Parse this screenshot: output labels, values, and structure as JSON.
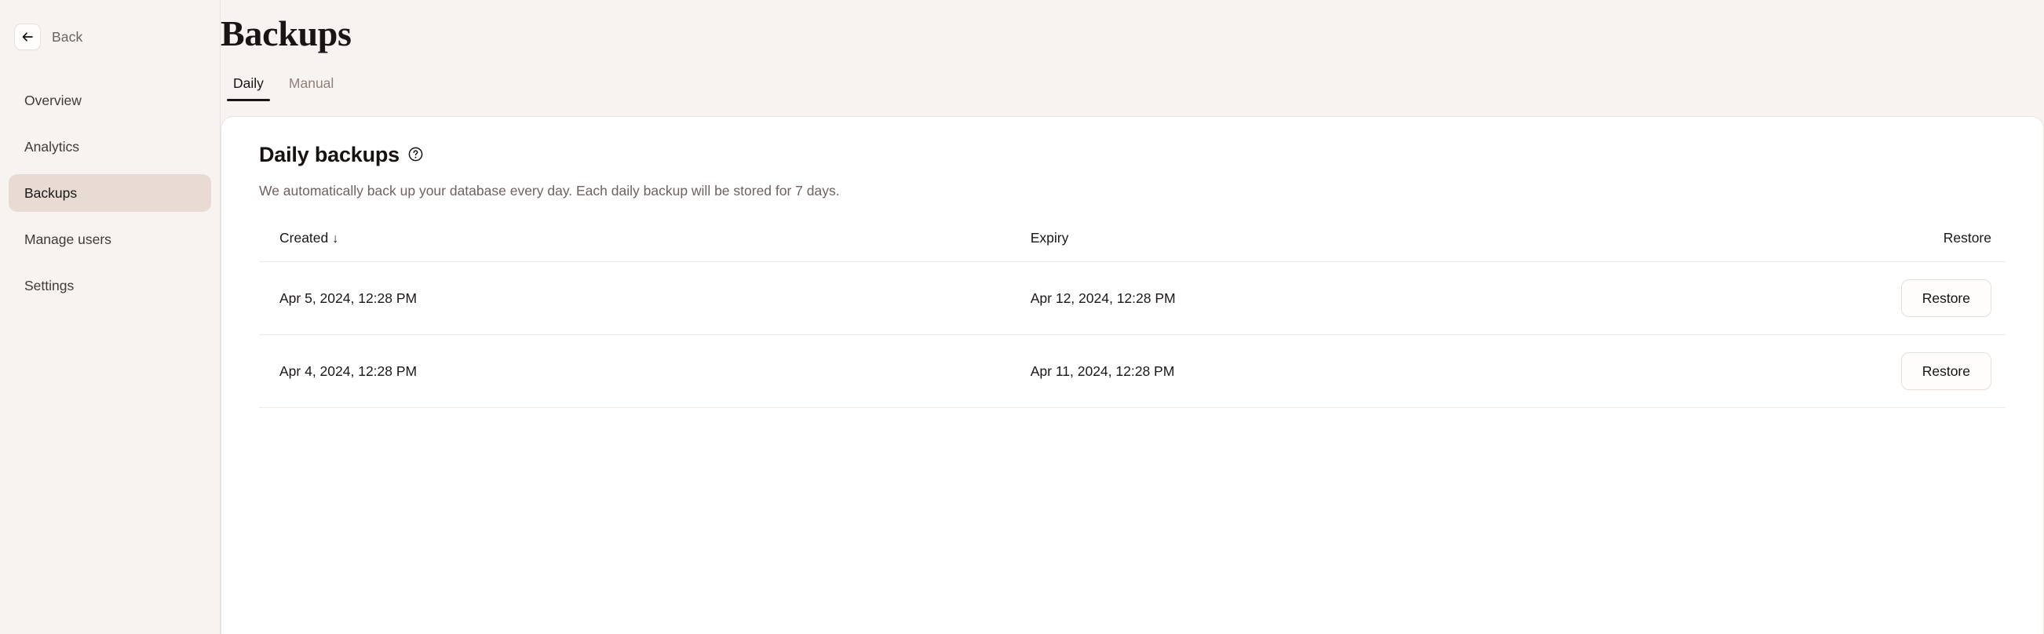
{
  "sidebar": {
    "back": {
      "label": "Back",
      "icon": "arrow-left-icon"
    },
    "items": [
      {
        "label": "Overview",
        "active": false
      },
      {
        "label": "Analytics",
        "active": false
      },
      {
        "label": "Backups",
        "active": true
      },
      {
        "label": "Manage users",
        "active": false
      },
      {
        "label": "Settings",
        "active": false
      }
    ]
  },
  "header": {
    "title": "Backups"
  },
  "tabs": [
    {
      "label": "Daily",
      "active": true
    },
    {
      "label": "Manual",
      "active": false
    }
  ],
  "card": {
    "title": "Daily backups",
    "help_icon": "help-circle-icon",
    "description": "We automatically back up your database every day. Each daily backup will be stored for 7 days.",
    "table": {
      "columns": [
        {
          "key": "created",
          "label": "Created",
          "sort": "↓"
        },
        {
          "key": "expiry",
          "label": "Expiry"
        },
        {
          "key": "restore",
          "label": "Restore"
        }
      ],
      "rows": [
        {
          "created": "Apr 5, 2024, 12:28 PM",
          "expiry": "Apr 12, 2024, 12:28 PM",
          "action": "Restore"
        },
        {
          "created": "Apr 4, 2024, 12:28 PM",
          "expiry": "Apr 11, 2024, 12:28 PM",
          "action": "Restore"
        }
      ]
    }
  },
  "colors": {
    "page_bg": "#f7f3f0",
    "card_bg": "#ffffff",
    "active_nav_bg": "#e7dbd3",
    "text_primary": "#1a1514",
    "text_muted": "#6f625e",
    "border": "#efe8e3"
  }
}
